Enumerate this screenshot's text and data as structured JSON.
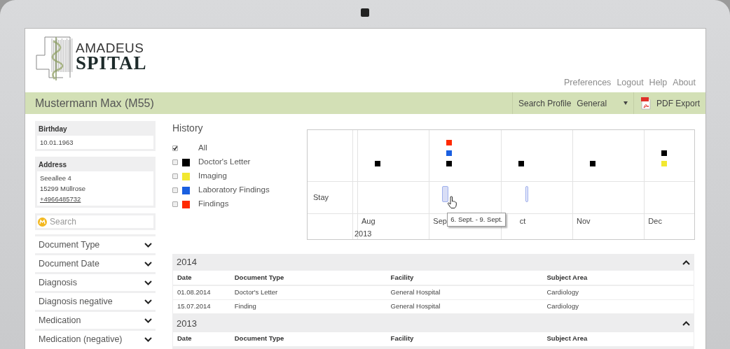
{
  "logo": {
    "line1": "AMADEUS",
    "line2": "SPITAL"
  },
  "top_links": [
    "Preferences",
    "Logout",
    "Help",
    "About"
  ],
  "patient_bar": {
    "name": "Mustermann Max (M55)",
    "search_profile_label": "Search Profile",
    "search_profile_value": "General",
    "export_label": "PDF Export"
  },
  "sidebar": {
    "cards": [
      {
        "title": "Birthday",
        "lines": [
          {
            "text": "10.01.1963",
            "kind": "text"
          }
        ]
      },
      {
        "title": "Address",
        "lines": [
          {
            "text": "Seeallee 4",
            "kind": "text"
          },
          {
            "text": "15299 Müllrose",
            "kind": "text"
          },
          {
            "text": "+4966485732",
            "kind": "link"
          }
        ]
      }
    ],
    "search": {
      "placeholder": "Search"
    },
    "filters": [
      {
        "label": "Document Type",
        "expanded": false
      },
      {
        "label": "Document Date",
        "expanded": false
      },
      {
        "label": "Diagnosis",
        "expanded": false
      },
      {
        "label": "Diagnosis negative",
        "expanded": false
      },
      {
        "label": "Medication",
        "expanded": false
      },
      {
        "label": "Medication (negative)",
        "expanded": false
      }
    ]
  },
  "history": {
    "title": "History",
    "legend": [
      {
        "label": "All",
        "checked": true
      },
      {
        "label": "Doctor's Letter",
        "checked": false,
        "color": "#000000"
      },
      {
        "label": "Imaging",
        "checked": false,
        "color": "#f2e830"
      },
      {
        "label": "Laboratory Findings",
        "checked": false,
        "color": "#1a5fe0"
      },
      {
        "label": "Findings",
        "checked": false,
        "color": "#ff2a00"
      }
    ],
    "timeline": {
      "row_label": "Stay",
      "year": "2013",
      "months": [
        {
          "label": "Aug",
          "events": [
            {
              "color": "#000000"
            }
          ]
        },
        {
          "label": "Sep",
          "events": [
            {
              "color": "#000000"
            },
            {
              "color": "#1a5fe0"
            },
            {
              "color": "#ff2a00"
            }
          ],
          "stays": [
            {
              "hovered": true,
              "tooltip": "6. Sept. - 9. Sept."
            }
          ]
        },
        {
          "label": "ct",
          "events": [
            {
              "color": "#000000"
            }
          ],
          "stays": [
            {
              "hovered": false
            }
          ]
        },
        {
          "label": "Nov",
          "events": [
            {
              "color": "#000000"
            }
          ]
        },
        {
          "label": "Dec",
          "events": [
            {
              "color": "#f2e830"
            },
            {
              "color": "#000000"
            }
          ]
        }
      ]
    }
  },
  "documents": [
    {
      "year": "2014",
      "expanded": true,
      "columns": [
        "Date",
        "Document Type",
        "Facility",
        "Subject Area"
      ],
      "rows": [
        [
          "01.08.2014",
          "Doctor's Letter",
          "General Hospital",
          "Cardiology"
        ],
        [
          "15.07.2014",
          "Finding",
          "General Hospital",
          "Cardiology"
        ]
      ]
    },
    {
      "year": "2013",
      "expanded": true,
      "columns": [
        "Date",
        "Document Type",
        "Facility",
        "Subject Area"
      ]
    }
  ]
}
